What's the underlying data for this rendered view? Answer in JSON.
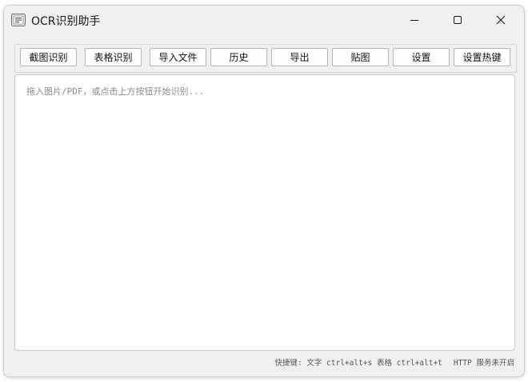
{
  "window": {
    "title": "OCR识别助手",
    "icons": {
      "app": "ocr-app-icon",
      "minimize": "minimize-icon",
      "maximize": "maximize-icon",
      "close": "close-icon"
    }
  },
  "toolbar": {
    "buttons": [
      {
        "label": "截图识别"
      },
      {
        "label": "表格识别"
      },
      {
        "label": "导入文件"
      },
      {
        "label": "历史"
      },
      {
        "label": "导出"
      },
      {
        "label": "贴图"
      },
      {
        "label": "设置"
      },
      {
        "label": "设置热键"
      }
    ]
  },
  "editor": {
    "placeholder": "拖入图片/PDF，或点击上方按钮开始识别..."
  },
  "statusbar": {
    "hotkeys": "快捷键: 文字 ctrl+alt+s  表格 ctrl+alt+t",
    "http": "HTTP 服务未开启"
  },
  "colors": {
    "window_bg": "#f0f0f0",
    "editor_bg": "#ffffff",
    "button_bg": "#fdfdfd",
    "border": "#b5b5b5"
  }
}
